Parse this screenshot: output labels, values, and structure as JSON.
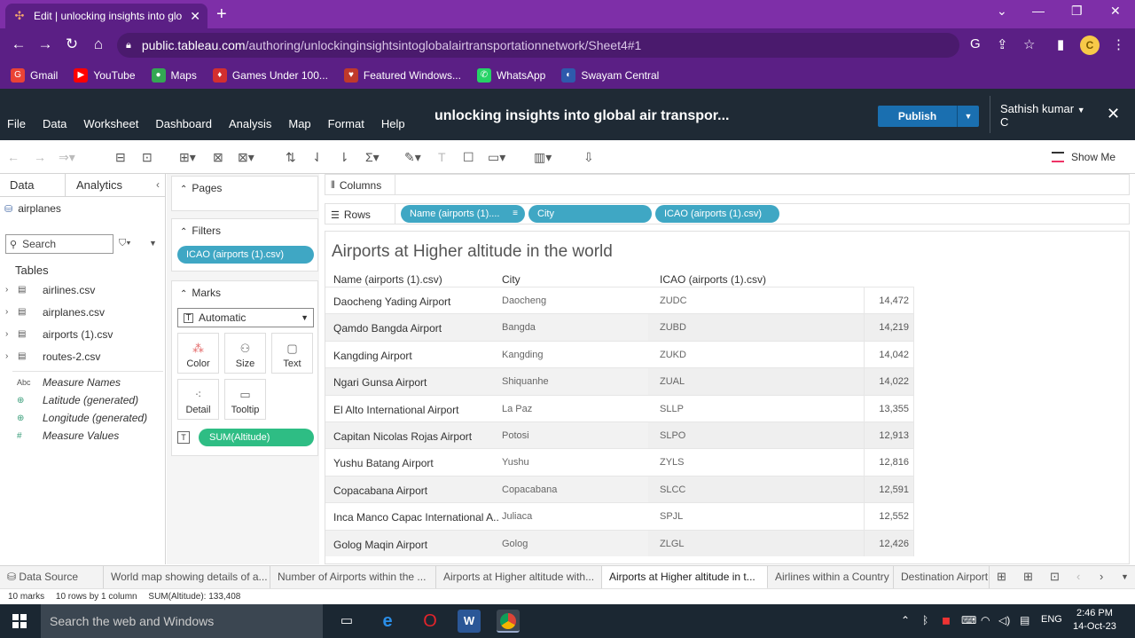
{
  "browser": {
    "tab_title": "Edit | unlocking insights into glo",
    "url_domain": "public.tableau.com",
    "url_path": "/authoring/unlockinginsightsintoglobalairtransportationnetwork/Sheet4#1",
    "profile_initial": "C",
    "bookmarks": [
      {
        "label": "Gmail",
        "color": "#ea4335",
        "glyph": "G"
      },
      {
        "label": "YouTube",
        "color": "#ff0000",
        "glyph": "▶"
      },
      {
        "label": "Maps",
        "color": "#34a853",
        "glyph": "●"
      },
      {
        "label": "Games Under 100...",
        "color": "#d32f2f",
        "glyph": "♦"
      },
      {
        "label": "Featured Windows...",
        "color": "#c0392b",
        "glyph": "♥"
      },
      {
        "label": "WhatsApp",
        "color": "#25d366",
        "glyph": "✆"
      },
      {
        "label": "Swayam Central",
        "color": "#2e5aac",
        "glyph": "◐"
      }
    ]
  },
  "app": {
    "menu": [
      "File",
      "Data",
      "Worksheet",
      "Dashboard",
      "Analysis",
      "Map",
      "Format",
      "Help"
    ],
    "workbook_title": "unlocking insights into global air transpor...",
    "publish_label": "Publish",
    "user_name_line1": "Sathish kumar",
    "user_name_line2": "C",
    "show_me_label": "Show Me"
  },
  "data_pane": {
    "tabs": [
      "Data",
      "Analytics"
    ],
    "datasource": "airplanes",
    "search_placeholder": "Search",
    "tables_heading": "Tables",
    "tables": [
      "airlines.csv",
      "airplanes.csv",
      "airports (1).csv",
      "routes-2.csv"
    ],
    "fields": [
      {
        "icon": "Abc",
        "name": "Measure Names"
      },
      {
        "icon": "⊕",
        "name": "Latitude (generated)"
      },
      {
        "icon": "⊕",
        "name": "Longitude (generated)"
      },
      {
        "icon": "#",
        "name": "Measure Values"
      }
    ]
  },
  "cards": {
    "pages_label": "Pages",
    "filters_label": "Filters",
    "filter_pill": "ICAO (airports (1).csv)",
    "marks_label": "Marks",
    "mark_type": "Automatic",
    "mark_buttons": [
      "Color",
      "Size",
      "Text",
      "Detail",
      "Tooltip"
    ],
    "measure_pill": "SUM(Altitude)"
  },
  "shelves": {
    "columns_label": "Columns",
    "rows_label": "Rows",
    "row_pills": [
      "Name (airports (1)....",
      "City",
      "ICAO (airports (1).csv)"
    ]
  },
  "viz": {
    "title": "Airports at Higher altitude in the world",
    "headers": [
      "Name (airports (1).csv)",
      "City",
      "ICAO (airports (1).csv)"
    ],
    "rows": [
      {
        "name": "Daocheng Yading Airport",
        "city": "Daocheng",
        "icao": "ZUDC",
        "value": "14,472"
      },
      {
        "name": "Qamdo Bangda Airport",
        "city": "Bangda",
        "icao": "ZUBD",
        "value": "14,219"
      },
      {
        "name": "Kangding Airport",
        "city": "Kangding",
        "icao": "ZUKD",
        "value": "14,042"
      },
      {
        "name": "Ngari Gunsa Airport",
        "city": "Shiquanhe",
        "icao": "ZUAL",
        "value": "14,022"
      },
      {
        "name": "El Alto International Airport",
        "city": "La Paz",
        "icao": "SLLP",
        "value": "13,355"
      },
      {
        "name": "Capitan Nicolas Rojas Airport",
        "city": "Potosi",
        "icao": "SLPO",
        "value": "12,913"
      },
      {
        "name": "Yushu Batang Airport",
        "city": "Yushu",
        "icao": "ZYLS",
        "value": "12,816"
      },
      {
        "name": "Copacabana Airport",
        "city": "Copacabana",
        "icao": "SLCC",
        "value": "12,591"
      },
      {
        "name": "Inca Manco Capac International A..",
        "city": "Juliaca",
        "icao": "SPJL",
        "value": "12,552"
      },
      {
        "name": "Golog Maqin Airport",
        "city": "Golog",
        "icao": "ZLGL",
        "value": "12,426"
      }
    ]
  },
  "sheet_tabs": {
    "data_source": "Data Source",
    "tabs": [
      "World map showing details of a...",
      "Number of Airports within the ...",
      "Airports at Higher altitude with...",
      "Airports at Higher altitude in t...",
      "Airlines within a Country",
      "Destination Airport"
    ],
    "active_index": 3
  },
  "status": {
    "marks": "10 marks",
    "rows_cols": "10 rows by 1 column",
    "sum": "SUM(Altitude): 133,408"
  },
  "taskbar": {
    "search_placeholder": "Search the web and Windows",
    "language": "ENG",
    "time": "2:46 PM",
    "date": "14-Oct-23"
  }
}
